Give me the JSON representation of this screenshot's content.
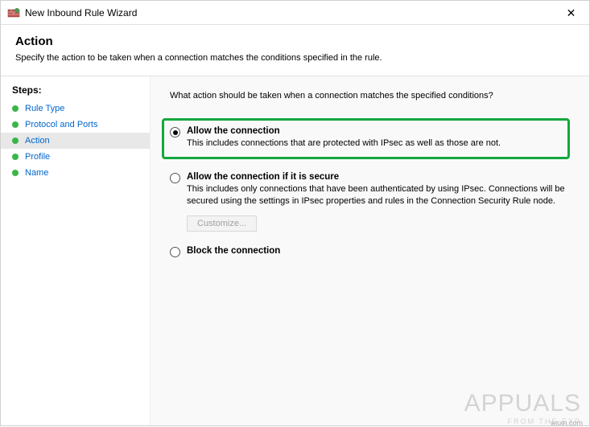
{
  "window": {
    "title": "New Inbound Rule Wizard"
  },
  "header": {
    "title": "Action",
    "subtitle": "Specify the action to be taken when a connection matches the conditions specified in the rule."
  },
  "sidebar": {
    "steps_label": "Steps:",
    "items": [
      {
        "label": "Rule Type",
        "active": false
      },
      {
        "label": "Protocol and Ports",
        "active": false
      },
      {
        "label": "Action",
        "active": true
      },
      {
        "label": "Profile",
        "active": false
      },
      {
        "label": "Name",
        "active": false
      }
    ]
  },
  "main": {
    "question": "What action should be taken when a connection matches the specified conditions?",
    "options": {
      "allow": {
        "title": "Allow the connection",
        "desc": "This includes connections that are protected with IPsec as well as those are not.",
        "checked": true
      },
      "allow_secure": {
        "title": "Allow the connection if it is secure",
        "desc": "This includes only connections that have been authenticated by using IPsec. Connections will be secured using the settings in IPsec properties and rules in the Connection Security Rule node.",
        "checked": false,
        "customize_label": "Customize..."
      },
      "block": {
        "title": "Block the connection",
        "checked": false
      }
    }
  },
  "watermark": {
    "brand": "APPUALS",
    "tagline": "FROM THE EXP",
    "site": "wsxn.com"
  }
}
